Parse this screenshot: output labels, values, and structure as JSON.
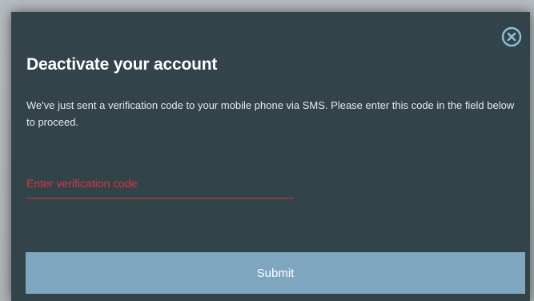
{
  "dialog": {
    "title": "Deactivate your account",
    "message": "We've just sent a verification code to your mobile phone via SMS. Please enter this code in the field below to proceed.",
    "close_icon": "close-circle-icon",
    "verification_input": {
      "value": "",
      "placeholder": "Enter verification code"
    },
    "submit_label": "Submit"
  },
  "colors": {
    "modal_background": "#33434a",
    "error_accent": "#d6363e",
    "submit_background": "#7ea6bf",
    "close_icon": "#8ebfd9"
  }
}
